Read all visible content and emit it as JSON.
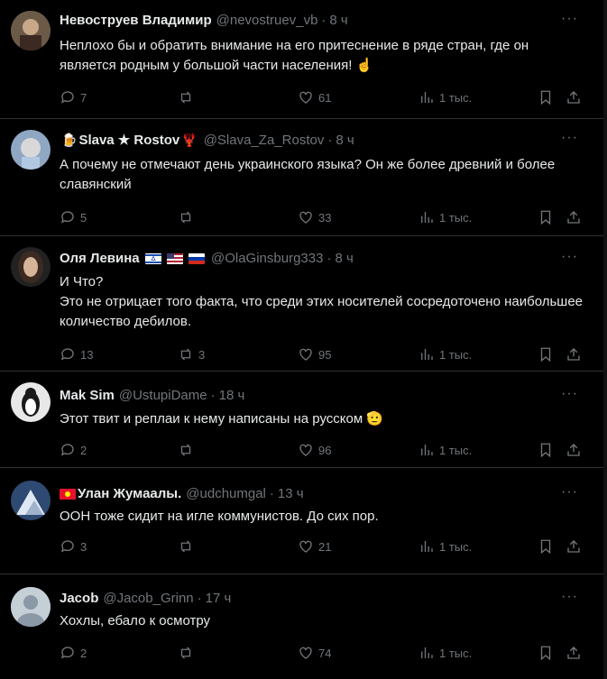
{
  "tweets": [
    {
      "name": "Невоструев Владимир",
      "handle": "@nevostruev_vb",
      "time": "8 ч",
      "text": "Неплохо бы и обратить внимание на его притеснение в ряде стран, где он является родным у большой части населения! ☝",
      "replies": "7",
      "retweets": "",
      "likes": "61",
      "views": "1 тыс."
    },
    {
      "name": "Slava ★ Rostov",
      "name_prefix": "🍺",
      "name_suffix": "🦞",
      "handle": "@Slava_Za_Rostov",
      "time": "8 ч",
      "text": "А почему не отмечают день украинского языка? Он же более древний и более славянский",
      "replies": "5",
      "retweets": "",
      "likes": "33",
      "views": "1 тыс."
    },
    {
      "name": "Оля Левина",
      "handle": "@OlaGinsburg333",
      "time": "8 ч",
      "text": "И Что?\nЭто не отрицает того факта, что среди этих носителей сосредоточено наибольшее количество дебилов.",
      "replies": "13",
      "retweets": "3",
      "likes": "95",
      "views": "1 тыс."
    },
    {
      "name": "Mak Sim",
      "handle": "@UstupiDame",
      "time": "18 ч",
      "text": "Этот твит и реплаи к нему написаны на русском 🫡",
      "replies": "2",
      "retweets": "",
      "likes": "96",
      "views": "1 тыс."
    },
    {
      "name": "Улан Жумаалы.",
      "handle": "@udchumgal",
      "time": "13 ч",
      "text": "ООН тоже сидит на игле коммунистов. До сих пор.",
      "replies": "3",
      "retweets": "",
      "likes": "21",
      "views": "1 тыс."
    },
    {
      "name": "Jacob",
      "handle": "@Jacob_Grinn",
      "time": "17 ч",
      "text": "Хохлы, ебало к осмотру",
      "replies": "2",
      "retweets": "",
      "likes": "74",
      "views": "1 тыс."
    }
  ],
  "more_label": "···",
  "dot": "·",
  "colors": {
    "background": "#000000",
    "text": "#e7e9ea",
    "muted": "#71767b",
    "border": "#2f3336"
  }
}
